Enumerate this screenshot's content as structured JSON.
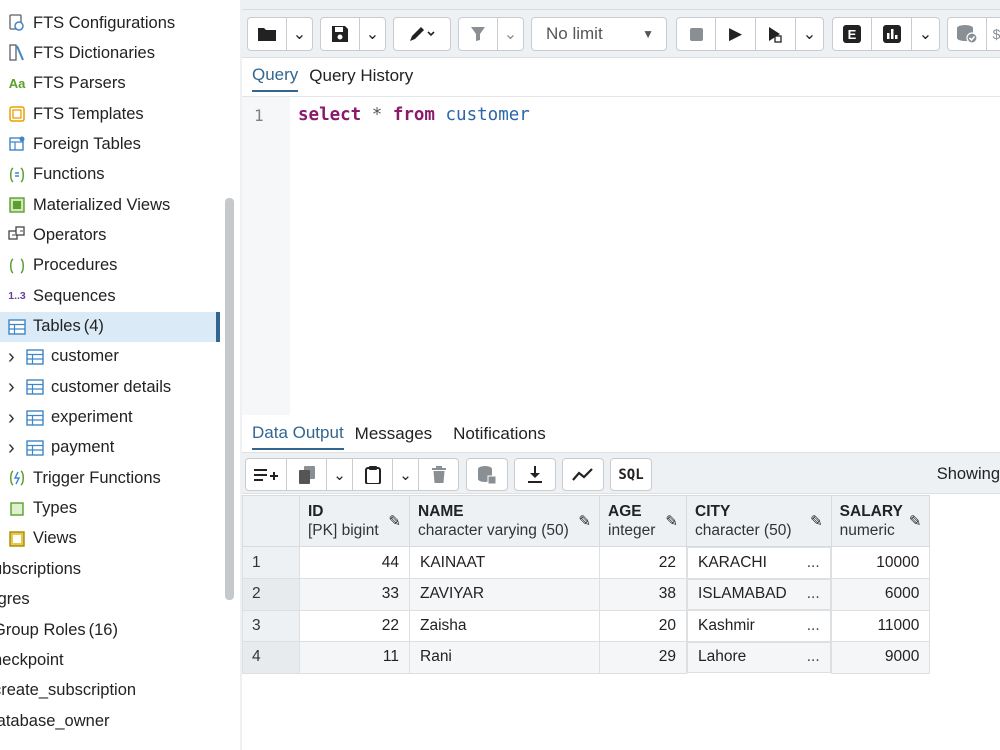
{
  "tree": {
    "items": [
      {
        "label": "FTS Configurations",
        "icon": "fts-configuration-icon"
      },
      {
        "label": "FTS Dictionaries",
        "icon": "fts-dictionary-icon"
      },
      {
        "label": "FTS Parsers",
        "icon": "fts-parser-icon",
        "glyph": "Aa"
      },
      {
        "label": "FTS Templates",
        "icon": "fts-template-icon"
      },
      {
        "label": "Foreign Tables",
        "icon": "foreign-table-icon"
      },
      {
        "label": "Functions",
        "icon": "function-icon"
      },
      {
        "label": "Materialized Views",
        "icon": "materialized-view-icon"
      },
      {
        "label": "Operators",
        "icon": "operator-icon"
      },
      {
        "label": "Procedures",
        "icon": "procedure-icon"
      },
      {
        "label": "Sequences",
        "icon": "sequence-icon",
        "glyph": "1..3"
      },
      {
        "label": "Tables",
        "count": "(4)",
        "icon": "table-icon",
        "selected": true
      },
      {
        "label": "customer",
        "icon": "table-icon",
        "child": true
      },
      {
        "label": "customer details",
        "icon": "table-icon",
        "child": true
      },
      {
        "label": "experiment",
        "icon": "table-icon",
        "child": true
      },
      {
        "label": "payment",
        "icon": "table-icon",
        "child": true
      },
      {
        "label": "Trigger Functions",
        "icon": "trigger-function-icon"
      },
      {
        "label": "Types",
        "icon": "type-icon"
      },
      {
        "label": "Views",
        "icon": "view-icon"
      },
      {
        "label": "ubscriptions",
        "outdent": true
      },
      {
        "label": "tgres",
        "outdent": true
      },
      {
        "label": "Group Roles",
        "count": "(16)",
        "outdent": true
      },
      {
        "label": "heckpoint",
        "outdent": true
      },
      {
        "label": "create_subscription",
        "outdent": true
      },
      {
        "label": "latabase_owner",
        "outdent": true
      }
    ]
  },
  "toolbar": {
    "limit_label": "No limit",
    "explain_label": "E"
  },
  "query_tabs": [
    "Query",
    "Query History"
  ],
  "editor": {
    "line_number": "1",
    "tokens": [
      {
        "text": "select",
        "kind": "kw"
      },
      {
        "text": " * ",
        "kind": "op"
      },
      {
        "text": "from",
        "kind": "kw"
      },
      {
        "text": " customer",
        "kind": "id"
      }
    ]
  },
  "output_tabs": [
    "Data Output",
    "Messages",
    "Notifications"
  ],
  "data_toolbar": {
    "sql_label": "SQL",
    "showing_label": "Showing"
  },
  "grid": {
    "columns": [
      {
        "name": "ID",
        "type": "[PK] bigint"
      },
      {
        "name": "NAME",
        "type": "character varying (50)"
      },
      {
        "name": "AGE",
        "type": "integer"
      },
      {
        "name": "CITY",
        "type": "character (50)"
      },
      {
        "name": "SALARY",
        "type": "numeric"
      }
    ],
    "rows": [
      {
        "n": "1",
        "id": "44",
        "name": "KAINAAT",
        "age": "22",
        "city": "KARACHI",
        "salary": "10000"
      },
      {
        "n": "2",
        "id": "33",
        "name": "ZAVIYAR",
        "age": "38",
        "city": "ISLAMABAD",
        "salary": "6000"
      },
      {
        "n": "3",
        "id": "22",
        "name": "Zaisha",
        "age": "20",
        "city": "Kashmir",
        "salary": "11000"
      },
      {
        "n": "4",
        "id": "11",
        "name": "Rani",
        "age": "29",
        "city": "Lahore",
        "salary": "9000"
      }
    ],
    "truncation_mark": "..."
  },
  "colors": {
    "accent": "#326690",
    "keyword": "#8b1a6b",
    "identifier": "#2a66a8",
    "icon_blue": "#3f86c6",
    "icon_green": "#5aa02c",
    "icon_orange": "#e8a000"
  }
}
